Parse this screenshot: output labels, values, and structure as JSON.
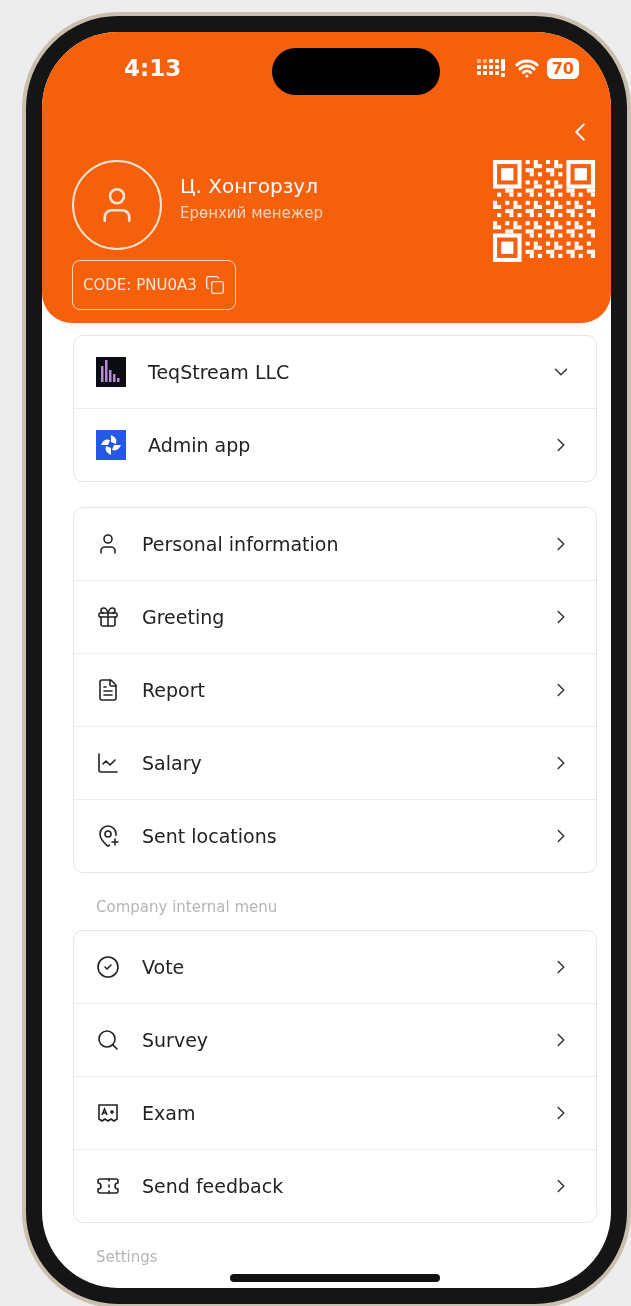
{
  "status_bar": {
    "time": "4:13",
    "battery": "70"
  },
  "profile": {
    "name": "Ц. Хонгорзул",
    "role": "Ерөнхий менежер",
    "code": "CODE: PNU0A3"
  },
  "sections": [
    {
      "items": [
        {
          "label": "TeqStream LLC",
          "kind": "dropdown"
        },
        {
          "label": "Admin app",
          "kind": "link"
        }
      ]
    },
    {
      "items": [
        {
          "label": "Personal information",
          "kind": "link"
        },
        {
          "label": "Greeting",
          "kind": "link"
        },
        {
          "label": "Report",
          "kind": "link"
        },
        {
          "label": "Salary",
          "kind": "link"
        },
        {
          "label": "Sent locations",
          "kind": "link"
        }
      ]
    },
    {
      "title": "Company internal menu",
      "items": [
        {
          "label": "Vote",
          "kind": "link"
        },
        {
          "label": "Survey",
          "kind": "link"
        },
        {
          "label": "Exam",
          "kind": "link"
        },
        {
          "label": "Send feedback",
          "kind": "link"
        }
      ]
    },
    {
      "title": "Settings"
    }
  ]
}
